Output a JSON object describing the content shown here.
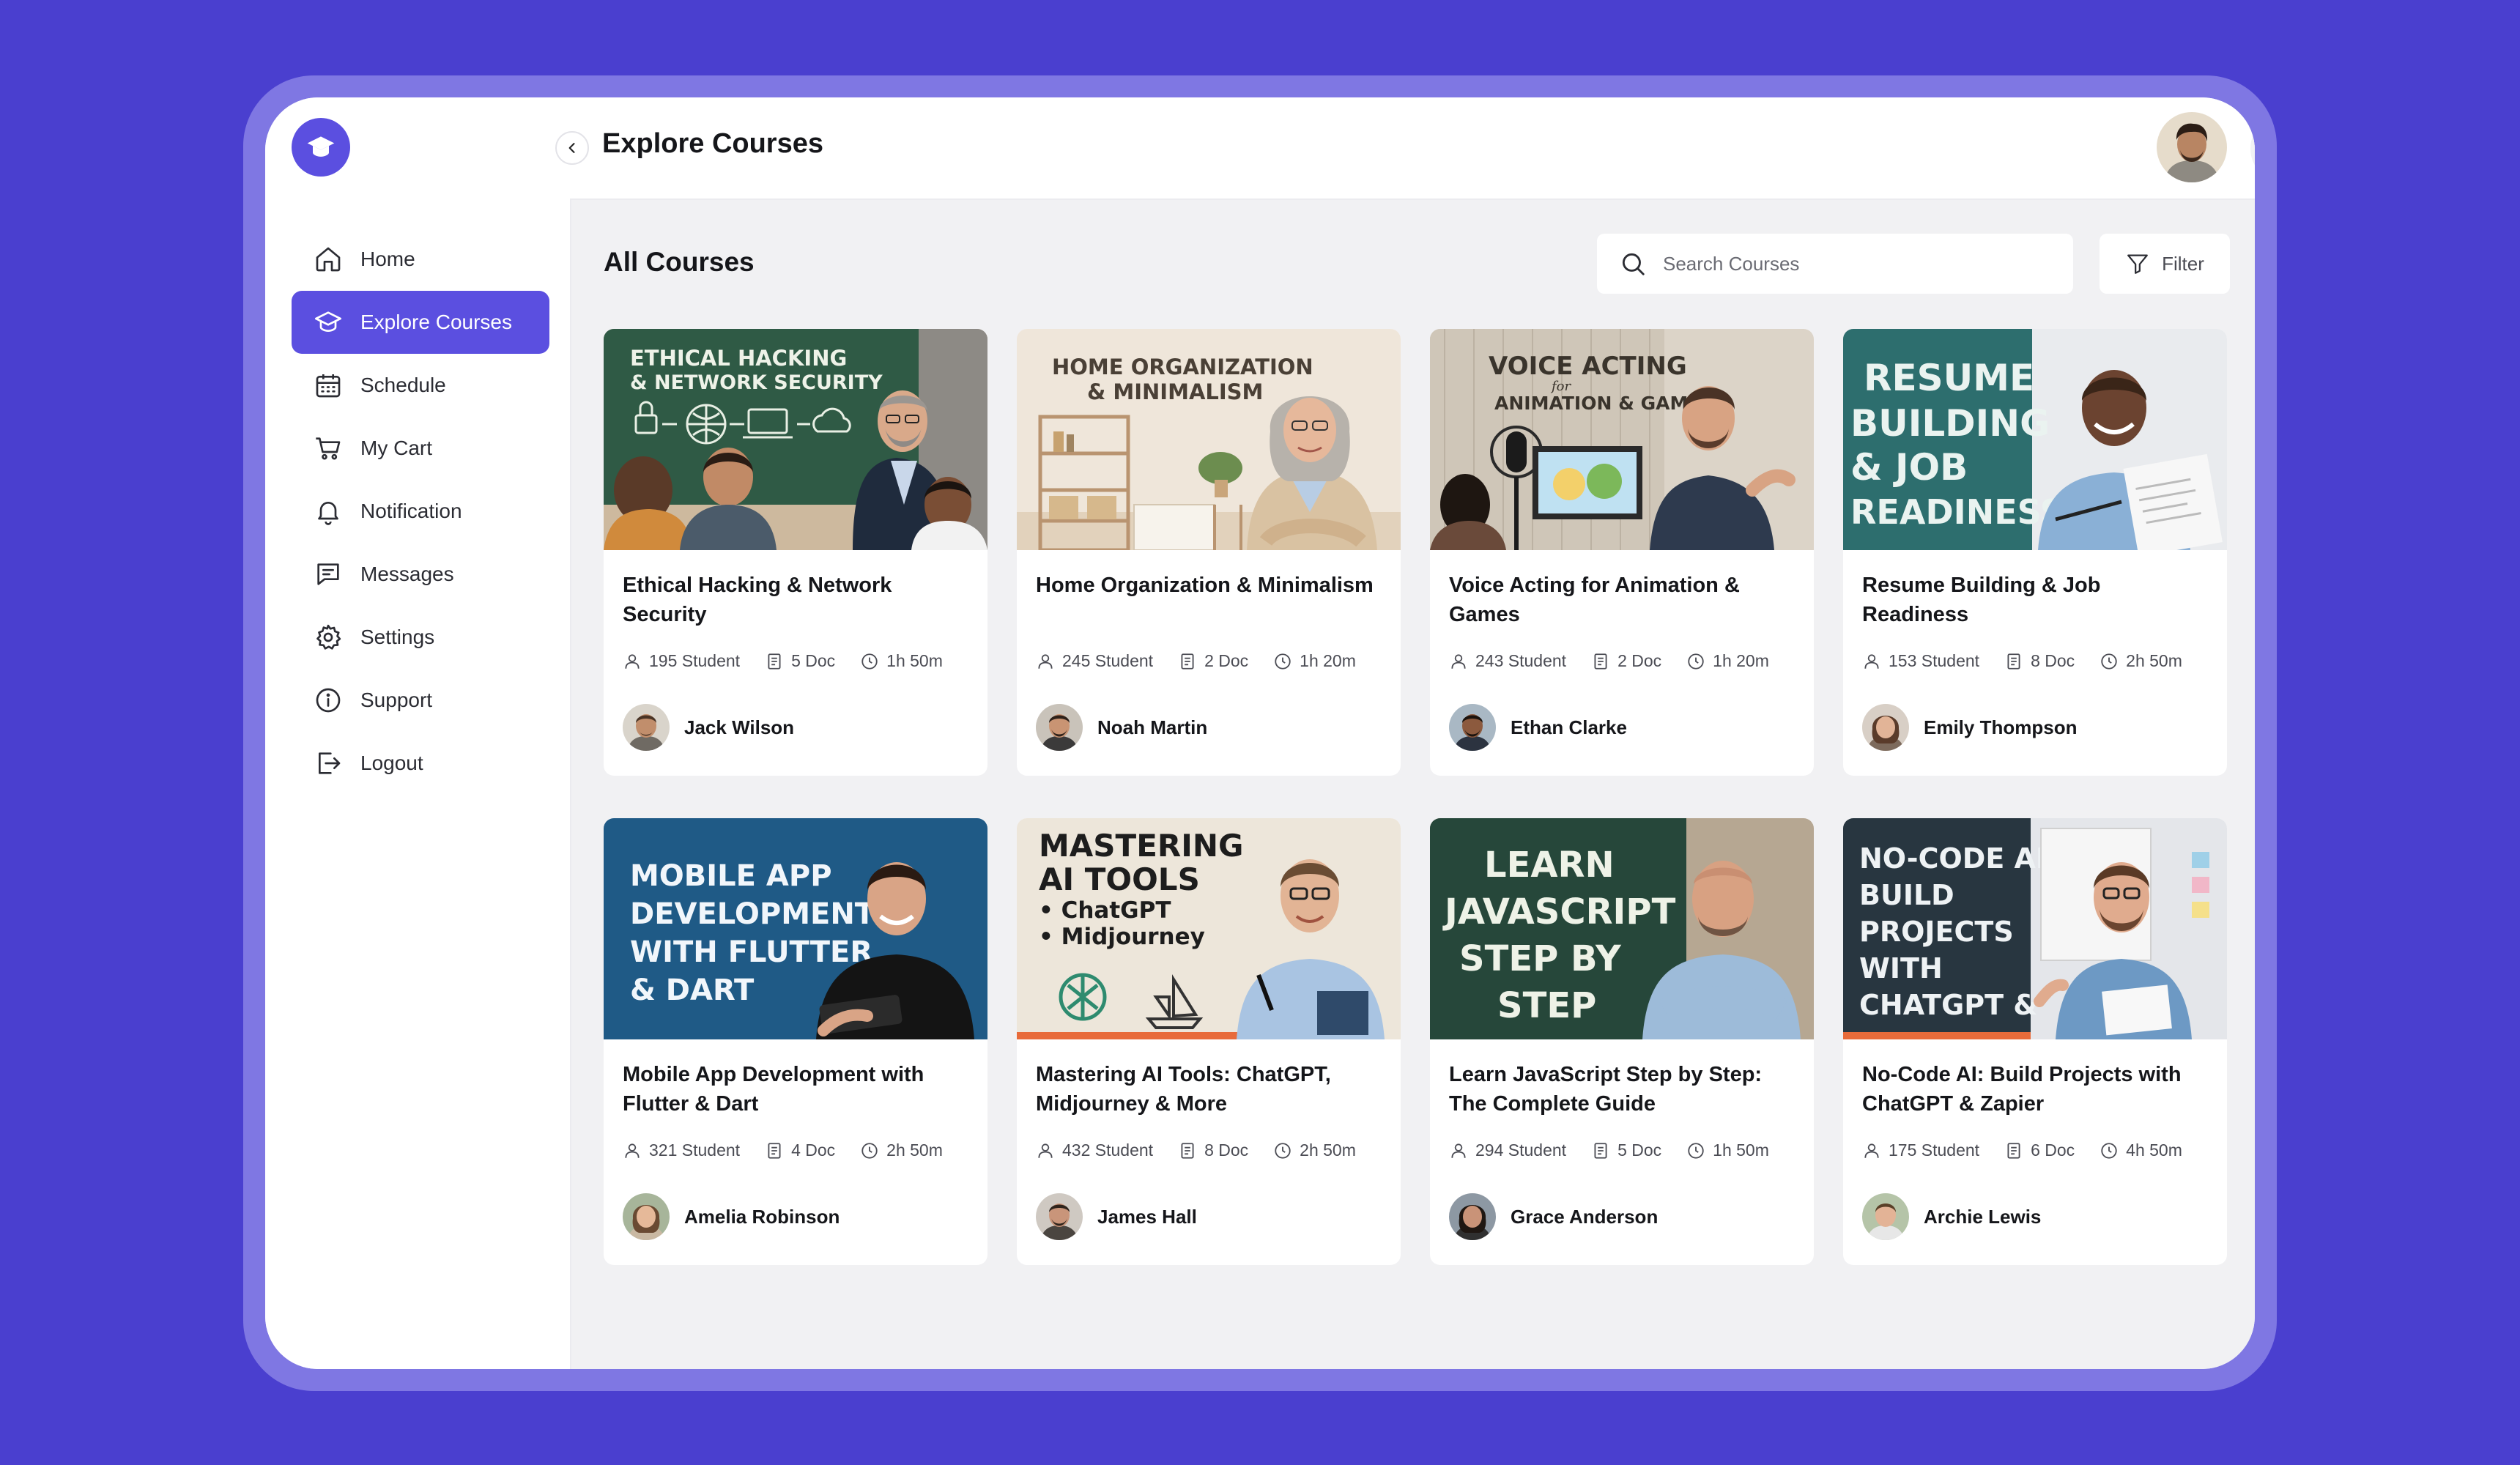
{
  "sidebar": {
    "items": [
      {
        "label": "Home",
        "icon": "home-icon"
      },
      {
        "label": "Explore Courses",
        "icon": "graduation-cap-icon",
        "active": true
      },
      {
        "label": "Schedule",
        "icon": "calendar-icon"
      },
      {
        "label": "My Cart",
        "icon": "cart-icon"
      },
      {
        "label": "Notification",
        "icon": "bell-icon"
      },
      {
        "label": "Messages",
        "icon": "message-icon"
      },
      {
        "label": "Settings",
        "icon": "gear-icon"
      },
      {
        "label": "Support",
        "icon": "info-icon"
      },
      {
        "label": "Logout",
        "icon": "logout-icon"
      }
    ]
  },
  "header": {
    "title": "Explore Courses"
  },
  "main": {
    "section_title": "All Courses",
    "search": {
      "placeholder": "Search Courses",
      "value": ""
    },
    "filter_label": "Filter"
  },
  "courses": [
    {
      "title": "Ethical Hacking & Network Security",
      "students": "195 Student",
      "docs": "5 Doc",
      "duration": "1h 50m",
      "instructor": "Jack Wilson",
      "thumb": {
        "line1": "ETHICAL HACKING",
        "line2": "& NETWORK SECURITY"
      }
    },
    {
      "title": "Home Organization & Minimalism",
      "students": "245 Student",
      "docs": "2 Doc",
      "duration": "1h 20m",
      "instructor": "Noah Martin",
      "thumb": {
        "line1": "HOME ORGANIZATION",
        "line2": "& MINIMALISM"
      }
    },
    {
      "title": "Voice Acting for Animation & Games",
      "students": "243 Student",
      "docs": "2 Doc",
      "duration": "1h 20m",
      "instructor": "Ethan Clarke",
      "thumb": {
        "line1": "VOICE ACTING",
        "line2": "for",
        "line3": "ANIMATION & GAMES"
      }
    },
    {
      "title": "Resume Building & Job Readiness",
      "students": "153 Student",
      "docs": "8 Doc",
      "duration": "2h 50m",
      "instructor": "Emily Thompson",
      "thumb": {
        "line1": "RESUME",
        "line2": "BUILDING",
        "line3": "& JOB",
        "line4": "READINESS"
      }
    },
    {
      "title": "Mobile App Development with Flutter & Dart",
      "students": "321 Student",
      "docs": "4 Doc",
      "duration": "2h 50m",
      "instructor": "Amelia Robinson",
      "thumb": {
        "line1": "MOBILE APP",
        "line2": "DEVELOPMENT",
        "line3": "WITH FLUTTER",
        "line4": "& DART"
      }
    },
    {
      "title": "Mastering AI Tools: ChatGPT, Midjourney & More",
      "students": "432 Student",
      "docs": "8 Doc",
      "duration": "2h 50m",
      "instructor": "James Hall",
      "thumb": {
        "line1": "MASTERING",
        "line2": "AI TOOLS",
        "line3": "• ChatGPT",
        "line4": "• Midjourney"
      }
    },
    {
      "title": "Learn JavaScript Step by Step: The Complete Guide",
      "students": "294 Student",
      "docs": "5 Doc",
      "duration": "1h 50m",
      "instructor": "Grace Anderson",
      "thumb": {
        "line1": "LEARN",
        "line2": "JAVASCRIPT",
        "line3": "STEP BY",
        "line4": "STEP"
      }
    },
    {
      "title": "No-Code AI: Build Projects with ChatGPT & Zapier",
      "students": "175 Student",
      "docs": "6 Doc",
      "duration": "4h 50m",
      "instructor": "Archie Lewis",
      "thumb": {
        "line1": "NO-CODE AI:",
        "line2": "BUILD",
        "line3": "PROJECTS",
        "line4": "WITH",
        "line5": "CHATGPT &"
      }
    }
  ],
  "colors": {
    "background": "#4a3fcf",
    "frame": "#7f77e3",
    "accent": "#5b4fe0",
    "main_bg": "#f1f1f3",
    "card_bg": "#ffffff",
    "text": "#15161a",
    "muted": "#4b4c54"
  }
}
